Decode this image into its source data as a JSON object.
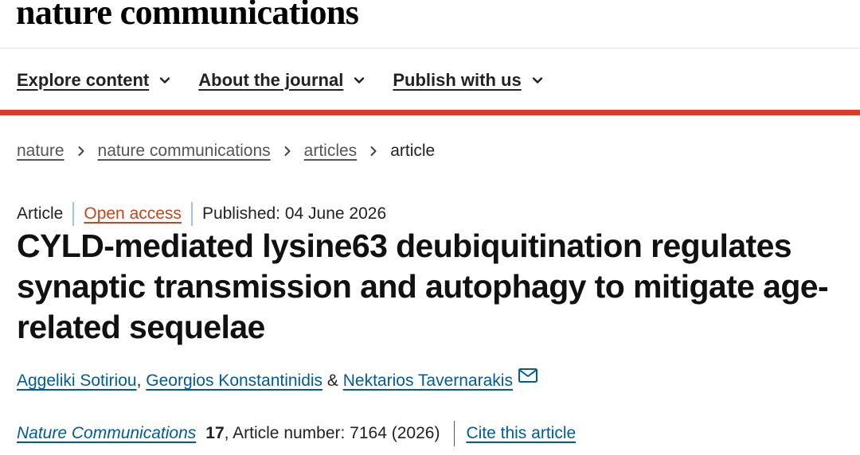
{
  "header": {
    "logo": "nature communications"
  },
  "nav": {
    "items": [
      {
        "label": "Explore content"
      },
      {
        "label": "About the journal"
      },
      {
        "label": "Publish with us"
      }
    ]
  },
  "breadcrumb": {
    "items": [
      "nature",
      "nature communications",
      "articles"
    ],
    "current": "article"
  },
  "article": {
    "type": "Article",
    "access": "Open access",
    "published": "Published: 04 June 2026",
    "title": "CYLD-mediated lysine63 deubiquitination regulates synaptic transmission and autophagy to mitigate age-related sequelae",
    "authors": [
      {
        "name": "Aggeliki Sotiriou",
        "after": ", "
      },
      {
        "name": "Georgios Konstantinidis",
        "after": " & "
      },
      {
        "name": "Nektarios Tavernarakis",
        "after": ""
      }
    ],
    "journal": "Nature Communications",
    "volume": "17",
    "article_number": ", Article number: 7164 (2026)",
    "cite": "Cite this article"
  },
  "colors": {
    "accent_red": "#e0392b",
    "link_blue": "#005a9c",
    "open_access": "#c4471c"
  }
}
